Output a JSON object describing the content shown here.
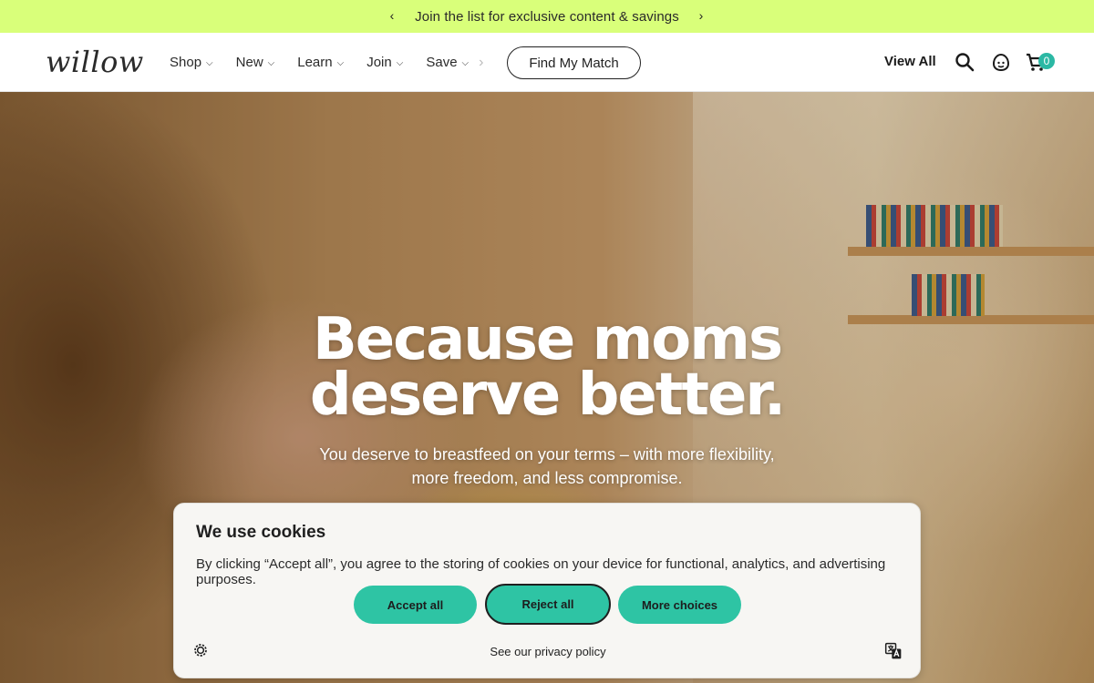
{
  "announcement": {
    "prev_arrow": "‹",
    "next_arrow": "›",
    "message": "Join the list for exclusive content & savings"
  },
  "header": {
    "logo": "willow",
    "nav": [
      {
        "label": "Shop"
      },
      {
        "label": "New"
      },
      {
        "label": "Learn"
      },
      {
        "label": "Join"
      },
      {
        "label": "Save"
      }
    ],
    "find_match_label": "Find My Match",
    "view_all_label": "View All",
    "cart_count": "0",
    "icons": [
      "search-icon",
      "account-icon",
      "cart-icon"
    ]
  },
  "hero": {
    "title_line1": "Because moms",
    "title_line2": "deserve better.",
    "subtitle_line1": "You deserve to breastfeed on your terms – with more flexibility,",
    "subtitle_line2": "more freedom, and less compromise."
  },
  "cookie_banner": {
    "title": "We use cookies",
    "description": "By clicking “Accept all”, you agree to the storing of cookies on your device for functional, analytics, and advertising purposes.",
    "accept_label": "Accept all",
    "reject_label": "Reject all",
    "more_label": "More choices",
    "privacy_label": "See our privacy policy"
  },
  "colors": {
    "announcement_bg": "#d9ff7a",
    "accent": "#2ec4a4",
    "badge": "#2bb8a4"
  }
}
